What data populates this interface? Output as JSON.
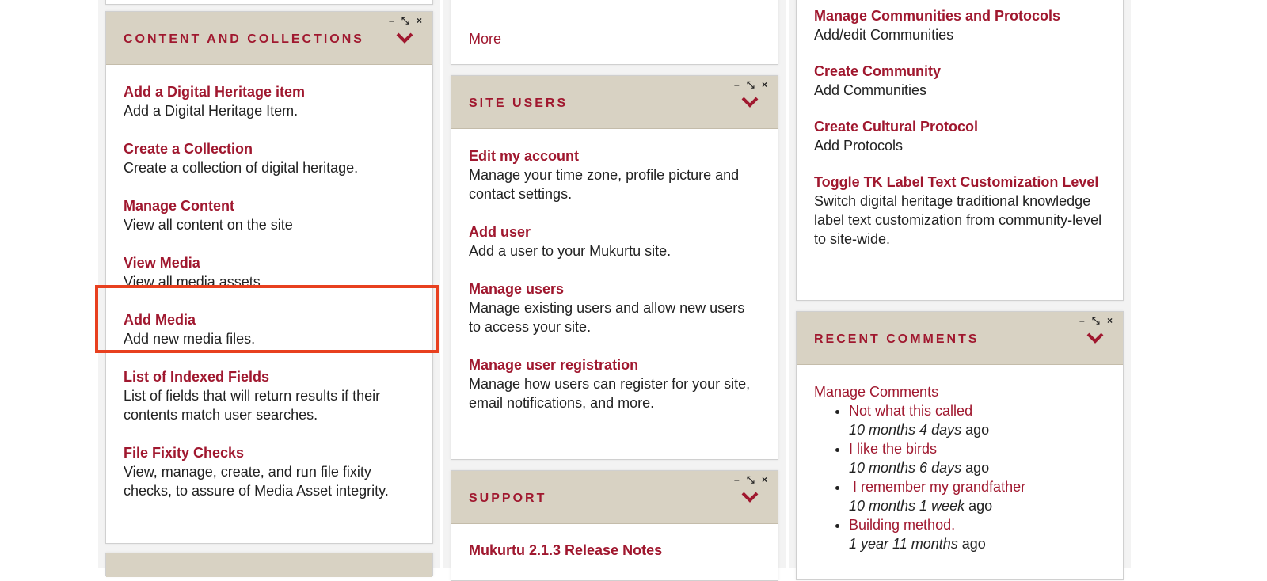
{
  "colors": {
    "accent": "#a0182f",
    "panel_header": "#d8d2c3",
    "highlight": "#e8401f"
  },
  "panel_controls": {
    "minimize": "–",
    "expand": "⤡",
    "close": "×"
  },
  "content_panel": {
    "title": "CONTENT AND COLLECTIONS",
    "items": [
      {
        "label": "Add a Digital Heritage item",
        "desc": "Add a Digital Heritage Item."
      },
      {
        "label": "Create a Collection",
        "desc": "Create a collection of digital heritage."
      },
      {
        "label": "Manage Content",
        "desc": "View all content on the site"
      },
      {
        "label": "View Media",
        "desc": "View all media assets."
      },
      {
        "label": "Add Media",
        "desc": "Add new media files."
      },
      {
        "label": "List of Indexed Fields",
        "desc": "List of fields that will return results if their contents match user searches."
      },
      {
        "label": "File Fixity Checks",
        "desc": "View, manage, create, and run file fixity checks, to assure of Media Asset integrity."
      }
    ]
  },
  "top_middle_panel": {
    "more_link": "More"
  },
  "users_panel": {
    "title": "SITE USERS",
    "items": [
      {
        "label": "Edit my account",
        "desc": "Manage your time zone, profile picture and contact settings."
      },
      {
        "label": "Add user",
        "desc": "Add a user to your Mukurtu site."
      },
      {
        "label": "Manage users",
        "desc": "Manage existing users and allow new users to access your site."
      },
      {
        "label": "Manage user registration",
        "desc": "Manage how users can register for your site, email notifications, and more."
      }
    ]
  },
  "support_panel": {
    "title": "SUPPORT",
    "items": [
      {
        "label": "Mukurtu 2.1.3 Release Notes"
      }
    ]
  },
  "communities_panel": {
    "items": [
      {
        "label": "Manage Communities and Protocols",
        "desc": "Add/edit Communities"
      },
      {
        "label": "Create Community",
        "desc": "Add Communities"
      },
      {
        "label": "Create Cultural Protocol",
        "desc": "Add Protocols"
      },
      {
        "label": "Toggle TK Label Text Customization Level",
        "desc": "Switch digital heritage traditional knowledge label text customization from community-level to site-wide."
      }
    ]
  },
  "comments_panel": {
    "title": "RECENT COMMENTS",
    "manage_link": "Manage Comments",
    "comments": [
      {
        "title": "Not what this called",
        "age": "10 months 4 days",
        "suffix": " ago"
      },
      {
        "title": "I like the birds",
        "age": "10 months 6 days",
        "suffix": " ago"
      },
      {
        "title": " I remember my grandfather",
        "age": "10 months 1 week",
        "suffix": " ago"
      },
      {
        "title": "Building method.",
        "age": "1 year 11 months",
        "suffix": " ago"
      }
    ]
  }
}
